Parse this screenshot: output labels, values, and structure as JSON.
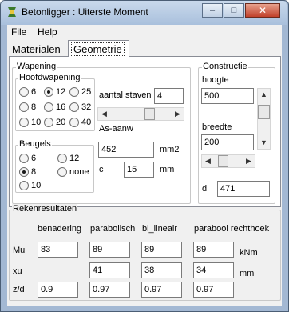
{
  "window": {
    "title": "Betonligger : Uiterste Moment",
    "minimize_glyph": "–",
    "maximize_glyph": "□",
    "close_glyph": "✕"
  },
  "menu": {
    "items": [
      "File",
      "Help"
    ]
  },
  "tabs": [
    {
      "label": "Materialen",
      "active": false
    },
    {
      "label": "Geometrie",
      "active": true
    }
  ],
  "wapening": {
    "group_title": "Wapening",
    "hoofdwapening": {
      "title": "Hoofdwapening",
      "options": [
        "6",
        "8",
        "10",
        "12",
        "16",
        "20",
        "25",
        "32",
        "40"
      ],
      "selected": "12"
    },
    "aantal_staven": {
      "label": "aantal staven",
      "value": "4"
    },
    "as_aanw": {
      "label": "As-aanw",
      "value": "452",
      "unit": "mm2"
    },
    "c": {
      "label": "c",
      "value": "15",
      "unit": "mm"
    },
    "beugels": {
      "title": "Beugels",
      "options": [
        "6",
        "8",
        "10",
        "12",
        "none"
      ],
      "selected": "8"
    }
  },
  "constructie": {
    "group_title": "Constructie",
    "hoogte": {
      "label": "hoogte",
      "value": "500"
    },
    "breedte": {
      "label": "breedte",
      "value": "200"
    },
    "d": {
      "label": "d",
      "value": "471"
    }
  },
  "results": {
    "group_title": "Rekenresultaten",
    "columns": [
      "benadering",
      "parabolisch",
      "bi_lineair",
      "parabool rechthoek"
    ],
    "rows": [
      {
        "label": "Mu",
        "values": [
          "83",
          "89",
          "89",
          "89"
        ],
        "unit": "kNm"
      },
      {
        "label": "xu",
        "values": [
          "",
          "41",
          "38",
          "34"
        ],
        "unit": "mm"
      },
      {
        "label": "z/d",
        "values": [
          "0.9",
          "0.97",
          "0.97",
          "0.97"
        ],
        "unit": ""
      }
    ]
  },
  "colors": {
    "title_bar": "#b9cde5",
    "close_button": "#c9503a",
    "frame": "#a3b8d3"
  }
}
